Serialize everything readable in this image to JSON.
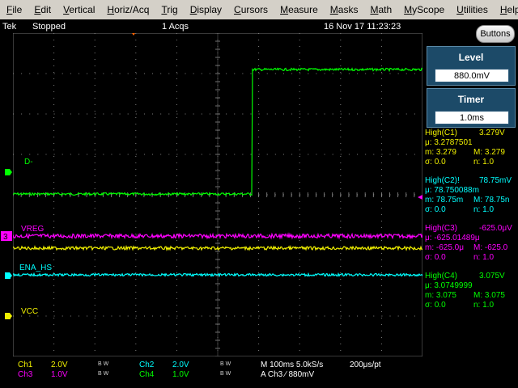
{
  "menu": [
    "File",
    "Edit",
    "Vertical",
    "Horiz/Acq",
    "Trig",
    "Display",
    "Cursors",
    "Measure",
    "Masks",
    "Math",
    "MyScope",
    "Utilities",
    "Help"
  ],
  "status": {
    "brand": "Tek",
    "state": "Stopped",
    "acqs": "1 Acqs",
    "datetime": "16 Nov 17 11:23:23"
  },
  "buttons_label": "Buttons",
  "level": {
    "title": "Level",
    "value": "880.0mV"
  },
  "timer": {
    "title": "Timer",
    "value": "1.0ms"
  },
  "measurements": [
    {
      "label": "High(C1)",
      "value": "3.279V",
      "mu": "μ: 3.2787501",
      "m": "m: 3.279",
      "M": "M: 3.279",
      "sigma": "σ: 0.0",
      "n": "n: 1.0",
      "color": "#f0f000"
    },
    {
      "label": "High(C2)!",
      "value": "78.75mV",
      "mu": "μ: 78.750088m",
      "m": "m: 78.75m",
      "M": "M: 78.75n",
      "sigma": "σ: 0.0",
      "n": "n: 1.0",
      "color": "#00ffff"
    },
    {
      "label": "High(C3)",
      "value": "-625.0μV",
      "mu": "μ: -625.01489μ",
      "m": "m: -625.0μ",
      "M": "M: -625.0",
      "sigma": "σ: 0.0",
      "n": "n: 1.0",
      "color": "#ff00ff"
    },
    {
      "label": "High(C4)",
      "value": "3.075V",
      "mu": "μ: 3.0749999",
      "m": "m: 3.075",
      "M": "M: 3.075",
      "sigma": "σ: 0.0",
      "n": "n: 1.0",
      "color": "#00ff00"
    }
  ],
  "traces": {
    "ch4_label": "D-",
    "ch3_label": "VREG",
    "ch2_label": "ENA_HS",
    "ch1_label": "VCC",
    "ch4_marker": "4",
    "ch3_marker": "3",
    "ch2_marker": "2",
    "ch1_marker": "1"
  },
  "readouts": {
    "ch1": "Ch1",
    "ch1_scale": "2.0V",
    "ch1_bw": "B W",
    "ch2": "Ch2",
    "ch2_scale": "2.0V",
    "ch2_bw": "B W",
    "ch3": "Ch3",
    "ch3_scale": "1.0V",
    "ch3_bw": "B W",
    "ch4": "Ch4",
    "ch4_scale": "1.0V",
    "ch4_bw": "B W",
    "horiz": "M 100ms 5.0kS/s",
    "respt": "200μs/pt",
    "trig": "A  Ch3  ∕  880mV"
  },
  "colors": {
    "ch1": "#f0f000",
    "ch2": "#00ffff",
    "ch3": "#ff00ff",
    "ch4": "#00ff00",
    "menu_bg": "#d4d0c8",
    "panel": "#1c4a68"
  }
}
